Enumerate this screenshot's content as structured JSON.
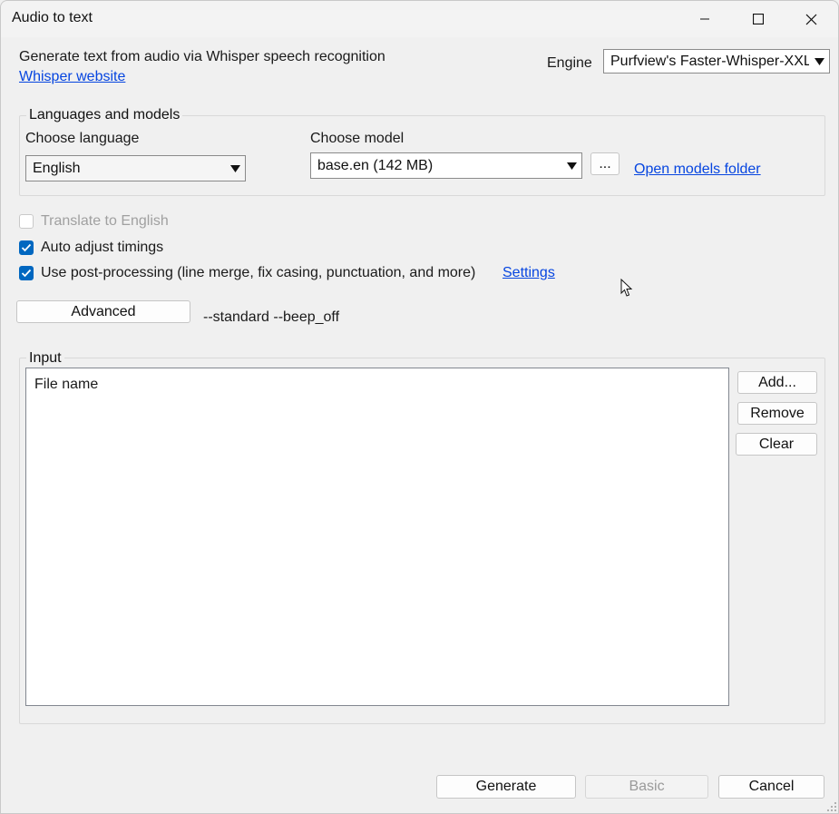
{
  "window": {
    "title": "Audio to text"
  },
  "header": {
    "description": "Generate text from audio via Whisper speech recognition",
    "website_link": "Whisper website",
    "engine_label": "Engine",
    "engine_value": "Purfview's Faster-Whisper-XXL"
  },
  "languages_models": {
    "group_title": "Languages and models",
    "language_label": "Choose language",
    "language_value": "English",
    "model_label": "Choose model",
    "model_value": "base.en (142 MB)",
    "browse_button": "...",
    "open_models_link": "Open models folder"
  },
  "options": {
    "translate": {
      "label": "Translate to English",
      "checked": false,
      "enabled": false
    },
    "auto_adjust": {
      "label": "Auto adjust timings",
      "checked": true,
      "enabled": true
    },
    "post_processing": {
      "label": "Use post-processing (line merge, fix casing, punctuation, and more)",
      "checked": true,
      "enabled": true
    },
    "settings_link": "Settings"
  },
  "advanced": {
    "button_label": "Advanced",
    "params": "--standard --beep_off"
  },
  "input": {
    "group_title": "Input",
    "column_header": "File name",
    "add_button": "Add...",
    "remove_button": "Remove",
    "clear_button": "Clear"
  },
  "footer": {
    "generate_button": "Generate",
    "basic_button": "Basic",
    "cancel_button": "Cancel"
  },
  "colors": {
    "accent": "#0067c0",
    "link": "#0645e0"
  }
}
